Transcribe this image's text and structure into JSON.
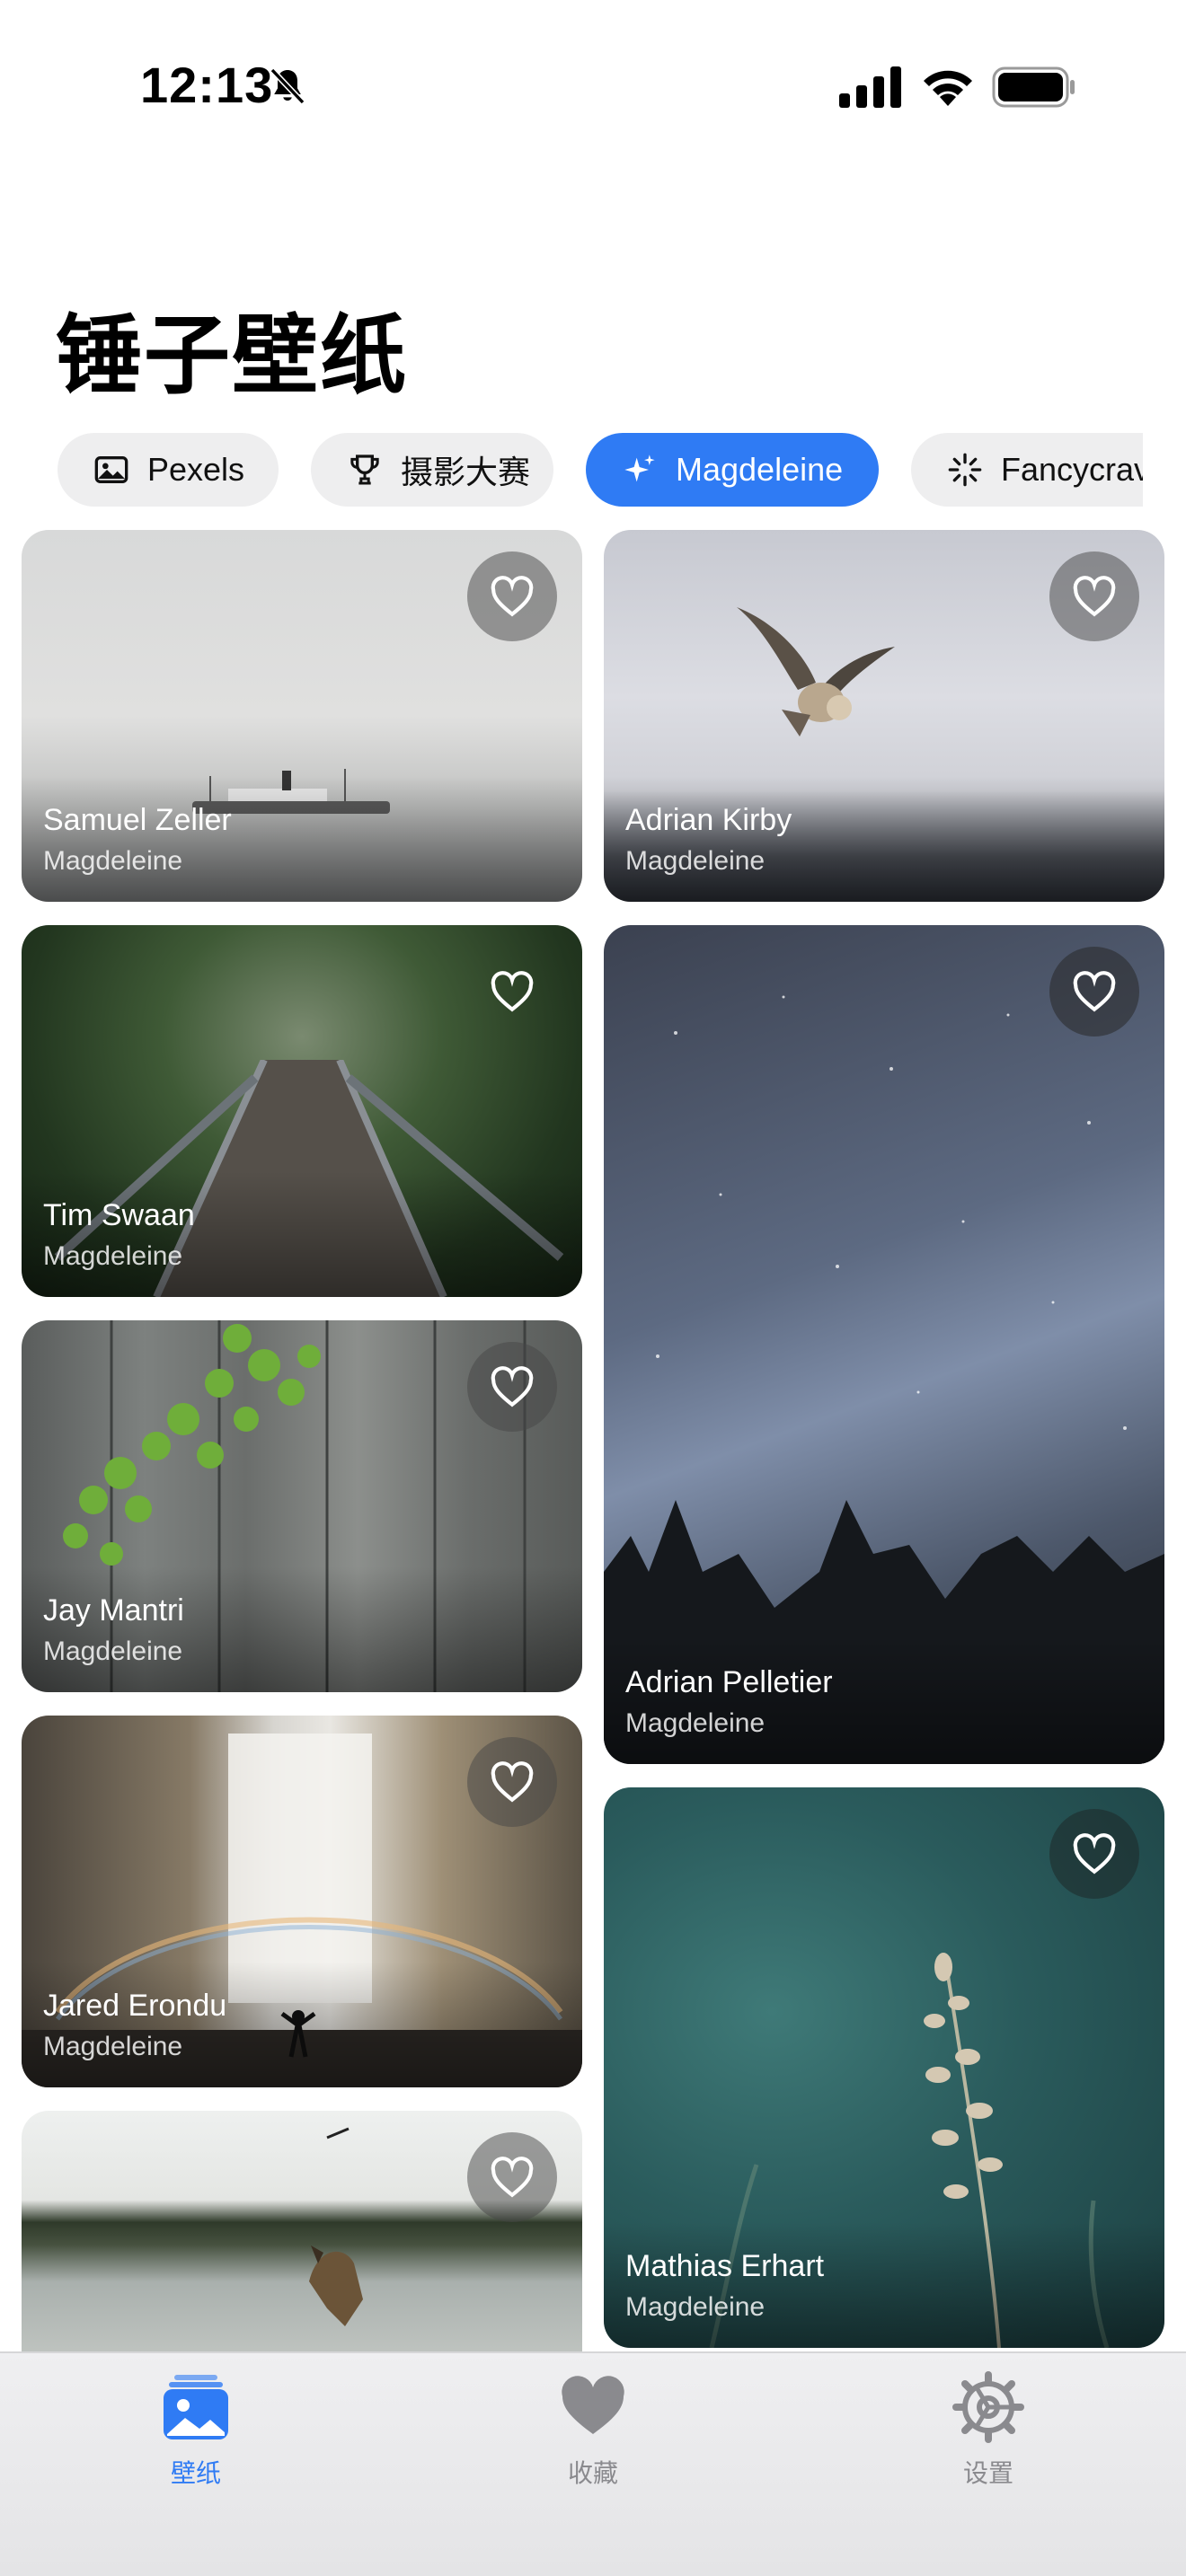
{
  "status_bar": {
    "time": "12:13",
    "icons": [
      "bell-slash-icon",
      "cellular-signal-icon",
      "wifi-icon",
      "battery-icon"
    ]
  },
  "title": "锤子壁纸",
  "chips": [
    {
      "label": "Pexels",
      "icon": "photo-icon",
      "active": false
    },
    {
      "label": "摄影大赛",
      "icon": "trophy-icon",
      "active": false
    },
    {
      "label": "Magdeleine",
      "icon": "sparkles-icon",
      "active": true
    },
    {
      "label": "Fancycrave",
      "icon": "burst-icon",
      "active": false
    }
  ],
  "cards": [
    {
      "author": "Samuel Zeller",
      "source": "Magdeleine",
      "scene": "foggy lake with steamboat"
    },
    {
      "author": "Adrian Kirby",
      "source": "Magdeleine",
      "scene": "owl in flight"
    },
    {
      "author": "Tim Swaan",
      "source": "Magdeleine",
      "scene": "bridge in forest"
    },
    {
      "author": "Adrian Pelletier",
      "source": "Magdeleine",
      "scene": "starry sky over trees"
    },
    {
      "author": "Jay Mantri",
      "source": "Magdeleine",
      "scene": "ivy on wooden wall"
    },
    {
      "author": "Jared Erondu",
      "source": "Magdeleine",
      "scene": "waterfall with rainbow"
    },
    {
      "author": "Mathias Erhart",
      "source": "Magdeleine",
      "scene": "grass stem on teal background"
    },
    {
      "author": "",
      "source": "",
      "scene": "dog jumping into lake"
    }
  ],
  "tabs": [
    {
      "label": "壁纸",
      "icon": "wallpaper-icon",
      "active": true
    },
    {
      "label": "收藏",
      "icon": "heart-icon",
      "active": false
    },
    {
      "label": "设置",
      "icon": "gear-icon",
      "active": false
    }
  ],
  "colors": {
    "accent": "#2f7bf4",
    "chip_bg": "#eeeeef",
    "tab_inactive": "#8a8a8e"
  }
}
